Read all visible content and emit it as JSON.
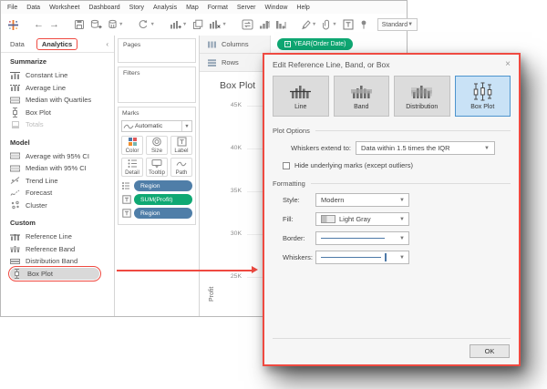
{
  "colors": {
    "accent_red": "#ef4a41",
    "pill_blue": "#4f7ea8",
    "pill_green": "#0fa873",
    "line_blue": "#4d79a8",
    "selected_bg": "#c9e2f6",
    "selected_border": "#4d94cd"
  },
  "menu": {
    "items": [
      "File",
      "Data",
      "Worksheet",
      "Dashboard",
      "Story",
      "Analysis",
      "Map",
      "Format",
      "Server",
      "Window",
      "Help"
    ]
  },
  "toolbar": {
    "fit_value": "Standard",
    "icons": [
      {
        "name": "tableau-logo-icon"
      },
      {
        "sep": true
      },
      {
        "name": "undo-icon"
      },
      {
        "name": "redo-icon"
      },
      {
        "sep": true
      },
      {
        "name": "save-icon"
      },
      {
        "name": "add-data-icon"
      },
      {
        "name": "data-source-icon",
        "caret": true
      },
      {
        "sep": true
      },
      {
        "name": "refresh-icon",
        "caret": true
      },
      {
        "sep": true
      },
      {
        "name": "new-worksheet-icon",
        "caret": true
      },
      {
        "name": "duplicate-sheet-icon"
      },
      {
        "name": "clear-sheet-icon",
        "caret": true
      },
      {
        "sep": true
      },
      {
        "name": "swap-axes-icon"
      },
      {
        "name": "sort-ascending-icon"
      },
      {
        "name": "sort-descending-icon"
      },
      {
        "sep": true
      },
      {
        "name": "highlight-icon",
        "caret": true
      },
      {
        "name": "format-icon",
        "caret": true
      },
      {
        "name": "show-labels-icon"
      },
      {
        "name": "fix-axes-icon"
      }
    ]
  },
  "sidebar": {
    "tabs": {
      "data": "Data",
      "analytics": "Analytics",
      "collapse_icon": "‹"
    },
    "sections": [
      {
        "title": "Summarize",
        "items": [
          {
            "label": "Constant Line",
            "icon": "constant-line-icon"
          },
          {
            "label": "Average Line",
            "icon": "average-line-icon"
          },
          {
            "label": "Median with Quartiles",
            "icon": "quartiles-icon"
          },
          {
            "label": "Box Plot",
            "icon": "box-whisker-icon"
          },
          {
            "label": "Totals",
            "icon": "totals-icon",
            "disabled": true
          }
        ]
      },
      {
        "title": "Model",
        "items": [
          {
            "label": "Average with 95% CI",
            "icon": "ci-band-icon"
          },
          {
            "label": "Median with 95% CI",
            "icon": "ci-band-icon"
          },
          {
            "label": "Trend Line",
            "icon": "trend-line-icon"
          },
          {
            "label": "Forecast",
            "icon": "forecast-icon"
          },
          {
            "label": "Cluster",
            "icon": "cluster-icon"
          }
        ]
      },
      {
        "title": "Custom",
        "items": [
          {
            "label": "Reference Line",
            "icon": "reference-line-icon"
          },
          {
            "label": "Reference Band",
            "icon": "reference-band-icon"
          },
          {
            "label": "Distribution Band",
            "icon": "distribution-band-icon"
          },
          {
            "label": "Box Plot",
            "icon": "box-whisker-icon",
            "highlighted": true
          }
        ]
      }
    ]
  },
  "cards": {
    "pages": "Pages",
    "filters": "Filters",
    "marks": "Marks",
    "mark_type": "Automatic"
  },
  "marks": {
    "buttons": [
      {
        "label": "Color",
        "icon": "color-icon"
      },
      {
        "label": "Size",
        "icon": "size-icon"
      },
      {
        "label": "Label",
        "icon": "label-icon"
      },
      {
        "label": "Detail",
        "icon": "detail-icon"
      },
      {
        "label": "Tooltip",
        "icon": "tooltip-icon"
      },
      {
        "label": "Path",
        "icon": "path-icon"
      }
    ],
    "pills": [
      {
        "field": "Region",
        "type": "dimension",
        "shelf_icon": "detail-shelf-icon"
      },
      {
        "field": "SUM(Profit)",
        "type": "measure",
        "shelf_icon": "text-shelf-icon"
      },
      {
        "field": "Region",
        "type": "dimension",
        "shelf_icon": "text-shelf-icon"
      }
    ]
  },
  "shelves": {
    "columns_label": "Columns",
    "rows_label": "Rows",
    "columns_pill": "YEAR(Order Date)",
    "pill_plus": "+"
  },
  "view": {
    "title": "Box Plot",
    "axis_ticks": [
      "45K",
      "40K",
      "35K",
      "30K",
      "25K"
    ],
    "axis_label": "Profit"
  },
  "dialog": {
    "title": "Edit Reference Line, Band, or Box",
    "close_glyph": "×",
    "type_buttons": [
      {
        "label": "Line",
        "icon": "dlg-line-icon"
      },
      {
        "label": "Band",
        "icon": "dlg-band-icon"
      },
      {
        "label": "Distribution",
        "icon": "dlg-distribution-icon"
      },
      {
        "label": "Box Plot",
        "icon": "dlg-boxplot-icon",
        "selected": true
      }
    ],
    "plot_options": {
      "header": "Plot Options",
      "whiskers_extend_label": "Whiskers extend to:",
      "whiskers_extend_value": "Data within 1.5 times the IQR",
      "hide_marks_label": "Hide underlying marks (except outliers)",
      "hide_marks_checked": false
    },
    "formatting": {
      "header": "Formatting",
      "style_label": "Style:",
      "style_value": "Modern",
      "fill_label": "Fill:",
      "fill_value": "Light Gray",
      "border_label": "Border:",
      "whiskers_label": "Whiskers:"
    },
    "ok_label": "OK"
  }
}
